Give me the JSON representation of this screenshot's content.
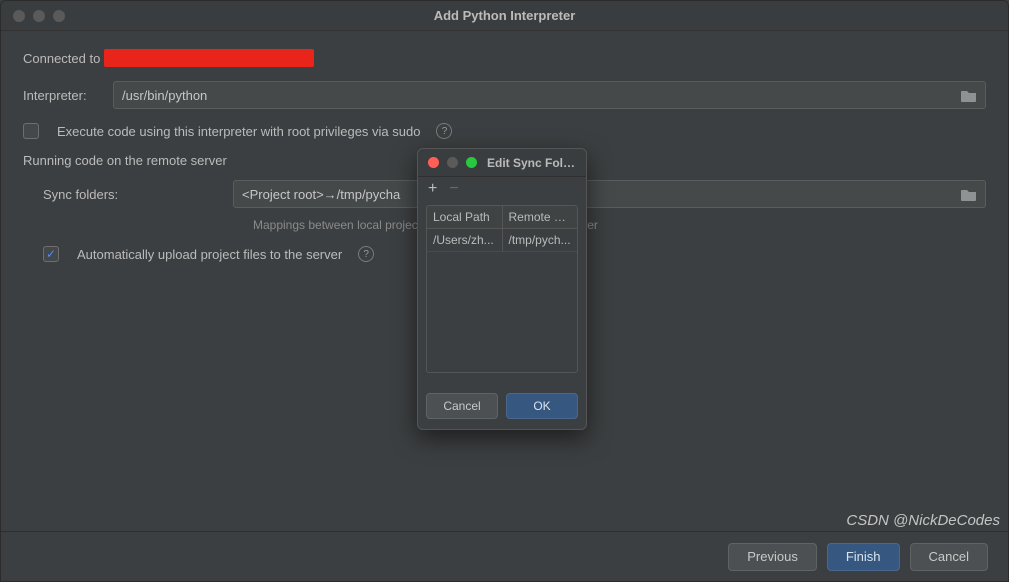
{
  "window": {
    "title": "Add Python Interpreter"
  },
  "connected_label": "Connected to",
  "interpreter": {
    "label": "Interpreter:",
    "value": "/usr/bin/python"
  },
  "sudo": {
    "label": "Execute code using this interpreter with root privileges via sudo",
    "checked": false
  },
  "remote": {
    "section_title": "Running code on the remote server",
    "sync_folders_label": "Sync folders:",
    "sync_folders_value": "<Project root>→/tmp/pycha",
    "mappings_caption": "Mappings between local project and remote folders on the server",
    "auto_upload_label": "Automatically upload project files to the server",
    "auto_upload_checked": true
  },
  "modal": {
    "title": "Edit Sync Fold...",
    "columns": {
      "local": "Local Path",
      "remote": "Remote Path"
    },
    "rows": [
      {
        "local": "/Users/zh...",
        "remote": "/tmp/pych..."
      }
    ],
    "cancel": "Cancel",
    "ok": "OK"
  },
  "buttons": {
    "previous": "Previous",
    "finish": "Finish",
    "cancel": "Cancel"
  },
  "watermark": "CSDN @NickDeCodes"
}
